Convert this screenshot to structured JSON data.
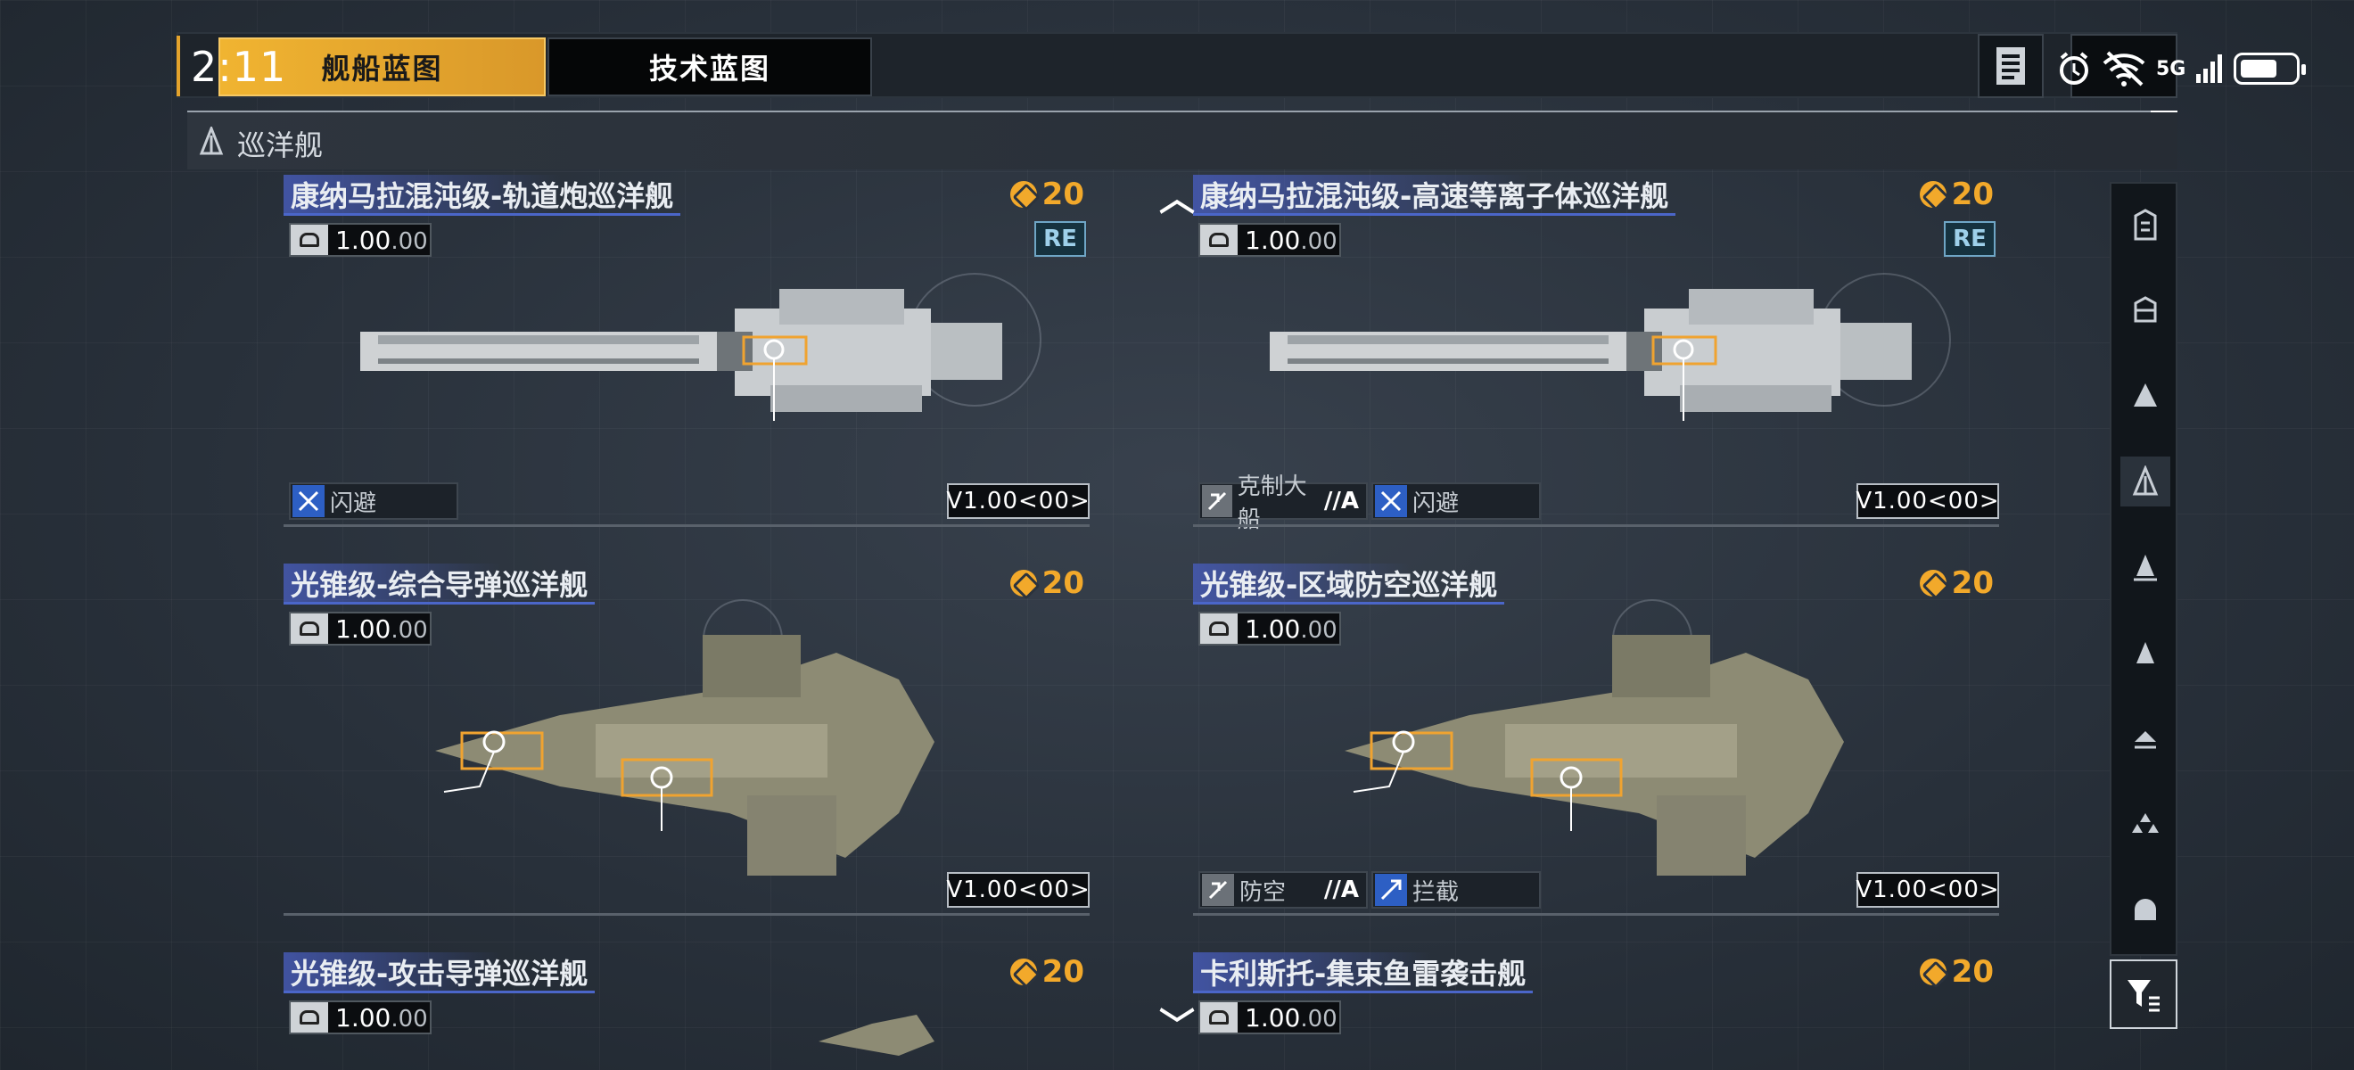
{
  "status_bar": {
    "time": "2:11",
    "network": "5G"
  },
  "tabs": [
    {
      "label": "舰船蓝图",
      "active": true
    },
    {
      "label": "技术蓝图",
      "active": false
    }
  ],
  "category": {
    "label": "巡洋舰"
  },
  "cards": [
    {
      "title": "康纳马拉混沌级-轨道炮巡洋舰",
      "cost": "20",
      "version_main": "1.00",
      "version_sub": ".00",
      "re_badge": "RE",
      "tags": [
        {
          "label": "闪避",
          "suffix": ""
        }
      ],
      "blueprint_version": "V1.00<00>"
    },
    {
      "title": "康纳马拉混沌级-高速等离子体巡洋舰",
      "cost": "20",
      "version_main": "1.00",
      "version_sub": ".00",
      "re_badge": "RE",
      "tags": [
        {
          "label": "克制大船",
          "suffix": "//A"
        },
        {
          "label": "闪避",
          "suffix": ""
        }
      ],
      "blueprint_version": "V1.00<00>"
    },
    {
      "title": "光锥级-综合导弹巡洋舰",
      "cost": "20",
      "version_main": "1.00",
      "version_sub": ".00",
      "tags": [],
      "blueprint_version": "V1.00<00>"
    },
    {
      "title": "光锥级-区域防空巡洋舰",
      "cost": "20",
      "version_main": "1.00",
      "version_sub": ".00",
      "tags": [
        {
          "label": "防空",
          "suffix": "//A"
        },
        {
          "label": "拦截",
          "suffix": ""
        }
      ],
      "blueprint_version": "V1.00<00>"
    },
    {
      "title": "光锥级-攻击导弹巡洋舰",
      "cost": "20",
      "version_main": "1.00",
      "version_sub": ".00"
    },
    {
      "title": "卡利斯托-集束鱼雷袭击舰",
      "cost": "20",
      "version_main": "1.00",
      "version_sub": ".00"
    }
  ],
  "sidebar": {
    "icons": [
      "carrier-icon",
      "battlecruiser-icon",
      "cruiser-heavy-icon",
      "cruiser-icon",
      "destroyer-icon",
      "frigate-icon",
      "corvette-icon",
      "fighter-icon",
      "aux-icon"
    ],
    "selected_index": 3
  },
  "colors": {
    "accent": "#f0b431",
    "cost": "#f2a92b",
    "title_bar": "#4b66c9",
    "panel": "#1e242b"
  }
}
